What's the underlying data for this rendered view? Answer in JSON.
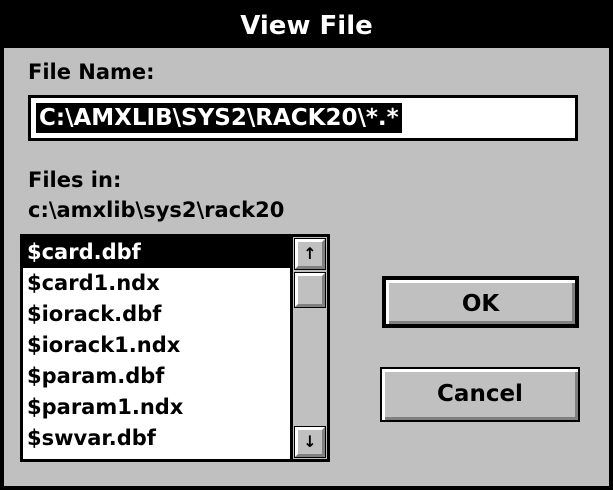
{
  "window": {
    "title": "View File"
  },
  "file_name": {
    "label": "File Name:",
    "value": "C:\\AMXLIB\\SYS2\\RACK20\\*.*"
  },
  "files_in": {
    "label": "Files in:",
    "path": "c:\\amxlib\\sys2\\rack20"
  },
  "file_list": {
    "items": [
      {
        "label": "$card.dbf",
        "selected": true
      },
      {
        "label": "$card1.ndx",
        "selected": false
      },
      {
        "label": "$iorack.dbf",
        "selected": false
      },
      {
        "label": "$iorack1.ndx",
        "selected": false
      },
      {
        "label": "$param.dbf",
        "selected": false
      },
      {
        "label": "$param1.ndx",
        "selected": false
      },
      {
        "label": "$swvar.dbf",
        "selected": false
      }
    ]
  },
  "buttons": {
    "ok": "OK",
    "cancel": "Cancel"
  },
  "icons": {
    "scroll_up": "↑",
    "scroll_down": "↓"
  }
}
